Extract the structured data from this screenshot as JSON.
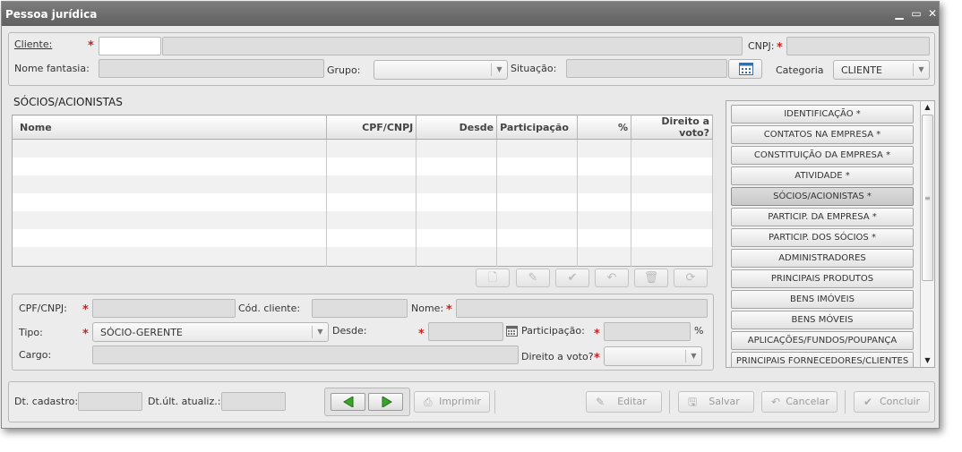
{
  "window": {
    "title": "Pessoa jurídica",
    "controls": {
      "minimize": "▁",
      "maximize": "▭",
      "close": "✕"
    }
  },
  "header": {
    "cliente_label": "Cliente:",
    "cnpj_label": "CNPJ:",
    "nome_fantasia_label": "Nome fantasia:",
    "grupo_label": "Grupo:",
    "situacao_label": "Situação:",
    "categoria_label": "Categoria",
    "categoria_value": "CLIENTE",
    "required_mark": "*"
  },
  "socios": {
    "title": "SÓCIOS/ACIONISTAS",
    "columns": [
      "Nome",
      "CPF/CNPJ",
      "Desde",
      "Participação",
      "%",
      "Direito a voto?"
    ],
    "rows": 7
  },
  "form": {
    "cpf_label": "CPF/CNPJ:",
    "cod_cliente_label": "Cód. cliente:",
    "nome_label": "Nome:",
    "tipo_label": "Tipo:",
    "tipo_value": "SÓCIO-GERENTE",
    "desde_label": "Desde:",
    "participacao_label": "Participação:",
    "percent": "%",
    "cargo_label": "Cargo:",
    "direito_label": "Direito a voto?"
  },
  "nav": {
    "items": [
      "IDENTIFICAÇÃO *",
      "CONTATOS NA EMPRESA *",
      "CONSTITUIÇÃO DA EMPRESA *",
      "ATIVIDADE *",
      "SÓCIOS/ACIONISTAS *",
      "PARTICIP. DA EMPRESA *",
      "PARTICIP. DOS SÓCIOS *",
      "ADMINISTRADORES",
      "PRINCIPAIS PRODUTOS",
      "BENS IMÓVEIS",
      "BENS MÓVEIS",
      "APLICAÇÕES/FUNDOS/POUPANÇA",
      "PRINCIPAIS FORNECEDORES/CLIENTES"
    ],
    "active_index": 4
  },
  "footer": {
    "dt_cadastro_label": "Dt. cadastro:",
    "dt_ult_label": "Dt.últ. atualiz.:",
    "imprimir": "Imprimir",
    "editar": "Editar",
    "salvar": "Salvar",
    "cancelar": "Cancelar",
    "concluir": "Concluir"
  },
  "colors": {
    "titlebar": "#6e6e6e",
    "required": "#d02020",
    "nav_arrow": "#3aa52b"
  }
}
